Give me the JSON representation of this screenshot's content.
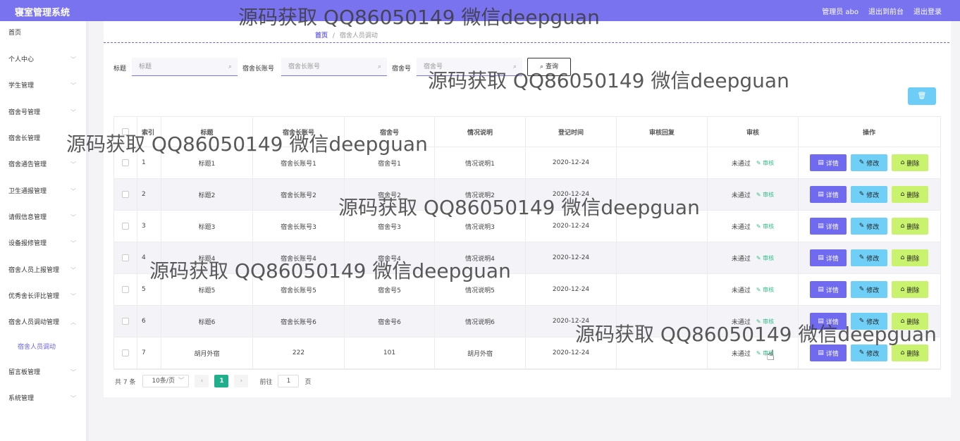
{
  "topbar": {
    "title": "寝室管理系统",
    "user": "管理员 abo",
    "back": "退出到前台",
    "logout": "退出登录"
  },
  "sidebar": {
    "items": [
      {
        "label": "首页",
        "chev": ""
      },
      {
        "label": "个人中心",
        "chev": "﹀"
      },
      {
        "label": "学生管理",
        "chev": "﹀"
      },
      {
        "label": "宿舍号管理",
        "chev": "﹀"
      },
      {
        "label": "宿舍长管理",
        "chev": "﹀"
      },
      {
        "label": "宿舍通告管理",
        "chev": "﹀"
      },
      {
        "label": "卫生通报管理",
        "chev": "﹀"
      },
      {
        "label": "请假信息管理",
        "chev": "﹀"
      },
      {
        "label": "设备报修管理",
        "chev": "﹀"
      },
      {
        "label": "宿舍人员上报管理",
        "chev": "﹀"
      },
      {
        "label": "优秀舍长评比管理",
        "chev": "﹀"
      },
      {
        "label": "宿舍人员调动管理",
        "chev": "︿"
      },
      {
        "label": "宿舍人员调动",
        "chev": ""
      },
      {
        "label": "留言板管理",
        "chev": "﹀"
      },
      {
        "label": "系统管理",
        "chev": "﹀"
      }
    ]
  },
  "breadcrumb": {
    "home": "首页",
    "sep": "/",
    "current": "宿舍人员调动"
  },
  "filters": {
    "title_label": "标题",
    "title_ph": "标题",
    "leader_label": "宿舍长账号",
    "leader_ph": "宿舍长账号",
    "room_label": "宿舍号",
    "room_ph": "宿舍号",
    "query": "查询"
  },
  "table": {
    "headers": [
      "",
      "索引",
      "标题",
      "宿舍长账号",
      "宿舍号",
      "情况说明",
      "登记时间",
      "审核回复",
      "审核",
      "操作"
    ],
    "rows": [
      {
        "idx": "1",
        "title": "标题1",
        "leader": "宿舍长账号1",
        "room": "宿舍号1",
        "desc": "情况说明1",
        "time": "2020-12-24",
        "reply": "",
        "status": "未通过",
        "audit": "审核"
      },
      {
        "idx": "2",
        "title": "标题2",
        "leader": "宿舍长账号2",
        "room": "宿舍号2",
        "desc": "情况说明2",
        "time": "2020-12-24",
        "reply": "",
        "status": "未通过",
        "audit": "审核"
      },
      {
        "idx": "3",
        "title": "标题3",
        "leader": "宿舍长账号3",
        "room": "宿舍号3",
        "desc": "情况说明3",
        "time": "2020-12-24",
        "reply": "",
        "status": "未通过",
        "audit": "审核"
      },
      {
        "idx": "4",
        "title": "标题4",
        "leader": "宿舍长账号4",
        "room": "宿舍号4",
        "desc": "情况说明4",
        "time": "2020-12-24",
        "reply": "",
        "status": "未通过",
        "audit": "审核"
      },
      {
        "idx": "5",
        "title": "标题5",
        "leader": "宿舍长账号5",
        "room": "宿舍号5",
        "desc": "情况说明5",
        "time": "2020-12-24",
        "reply": "",
        "status": "未通过",
        "audit": "审核"
      },
      {
        "idx": "6",
        "title": "标题6",
        "leader": "宿舍长账号6",
        "room": "宿舍号6",
        "desc": "情况说明6",
        "time": "2020-12-24",
        "reply": "",
        "status": "未通过",
        "audit": "审核"
      },
      {
        "idx": "7",
        "title": "胡月外宿",
        "leader": "222",
        "room": "101",
        "desc": "胡月外宿",
        "time": "2020-12-24",
        "reply": "",
        "status": "未通过",
        "audit": "审核"
      }
    ],
    "ops": {
      "detail": "详情",
      "edit": "修改",
      "delete": "删除"
    }
  },
  "pagination": {
    "total": "共 7 条",
    "page_size": "10条/页",
    "current": "1",
    "goto_label": "前往",
    "goto_value": "1",
    "page_unit": "页"
  },
  "watermark": "源码获取 QQ86050149 微信deepguan"
}
